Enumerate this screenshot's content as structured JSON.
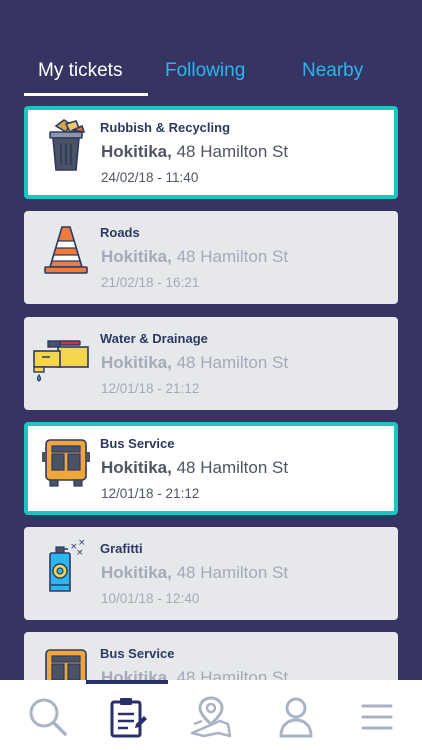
{
  "tabs": {
    "my_tickets": "My tickets",
    "following": "Following",
    "nearby": "Nearby"
  },
  "tickets": [
    {
      "category": "Rubbish & Recycling",
      "city": "Hokitika,",
      "street": " 48 Hamilton St",
      "datetime": "24/02/18 - 11:40",
      "icon": "rubbish-bin-icon",
      "selected": true
    },
    {
      "category": "Roads",
      "city": "Hokitika,",
      "street": " 48 Hamilton St",
      "datetime": "21/02/18 - 16:21",
      "icon": "traffic-cone-icon",
      "selected": false
    },
    {
      "category": "Water & Drainage",
      "city": "Hokitika,",
      "street": " 48 Hamilton St",
      "datetime": "12/01/18 - 21:12",
      "icon": "water-pipe-icon",
      "selected": false
    },
    {
      "category": "Bus Service",
      "city": "Hokitika,",
      "street": " 48 Hamilton St",
      "datetime": "12/01/18 - 21:12",
      "icon": "bus-icon",
      "selected": true
    },
    {
      "category": "Grafitti",
      "city": "Hokitika,",
      "street": " 48 Hamilton St",
      "datetime": "10/01/18 - 12:40",
      "icon": "spray-can-icon",
      "selected": false
    },
    {
      "category": "Bus Service",
      "city": "Hokitika,",
      "street": " 48 Hamilton St",
      "datetime": "",
      "icon": "bus-icon",
      "selected": false
    }
  ],
  "bottom_nav": [
    {
      "icon": "search-icon",
      "active": false
    },
    {
      "icon": "tickets-icon",
      "active": true
    },
    {
      "icon": "map-icon",
      "active": false
    },
    {
      "icon": "profile-icon",
      "active": false
    },
    {
      "icon": "menu-icon",
      "active": false
    }
  ],
  "colors": {
    "background": "#363462",
    "accent_teal": "#1ec4c0",
    "tab_blue": "#2ab6f0",
    "nav_active": "#2a2f6a",
    "nav_inactive": "#aab3c5"
  }
}
